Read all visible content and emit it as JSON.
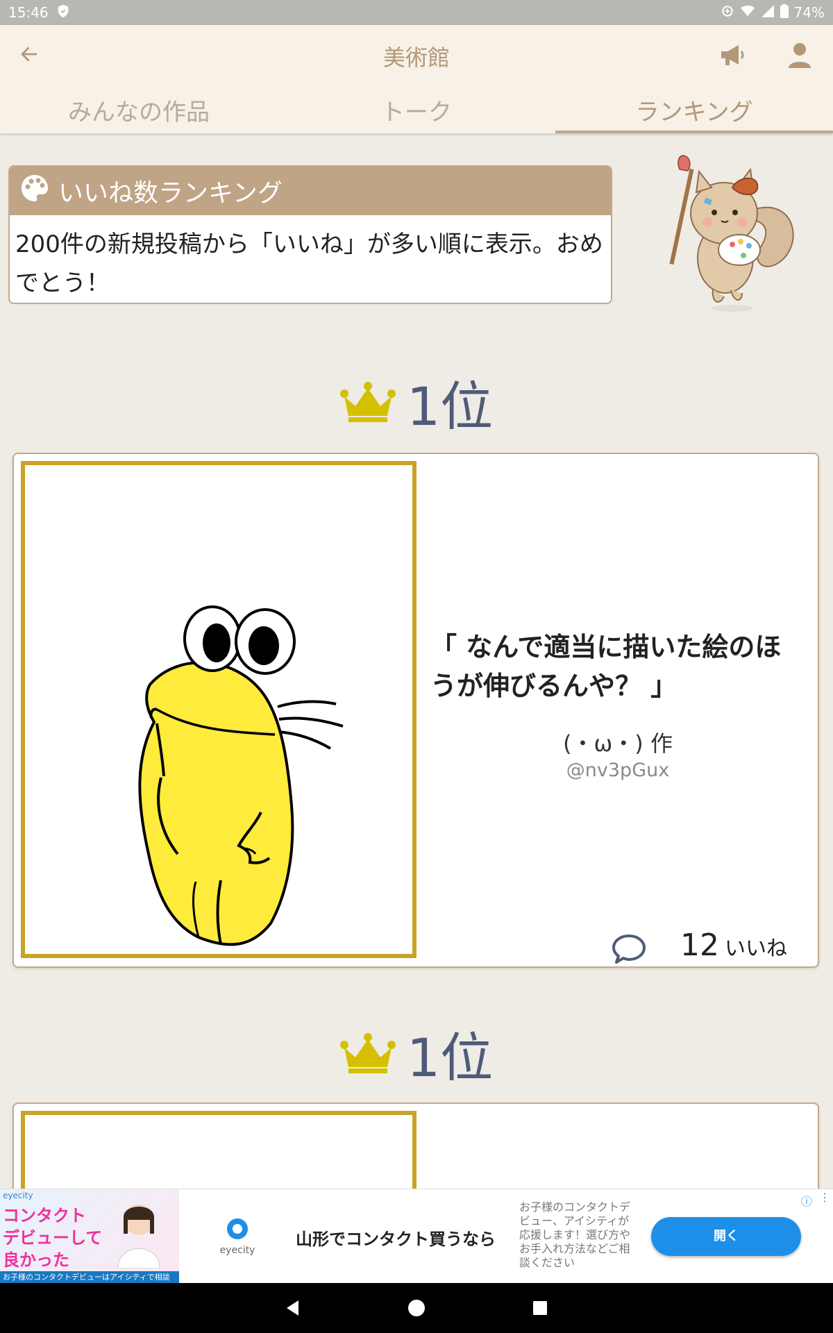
{
  "status_bar": {
    "time": "15:46",
    "battery": "74%"
  },
  "header": {
    "title": "美術館"
  },
  "tabs": [
    {
      "label": "みんなの作品",
      "active": false
    },
    {
      "label": "トーク",
      "active": false
    },
    {
      "label": "ランキング",
      "active": true
    }
  ],
  "ranking_info": {
    "title": "いいね数ランキング",
    "description": "200件の新規投稿から「いいね」が多い順に表示。おめでとう！"
  },
  "ranking": [
    {
      "rank_label": "1位",
      "title": "「 なんで適当に描いた絵のほうが伸びるんや？ 」",
      "author": "(・ω・) 作",
      "handle": "@nv3pGux",
      "likes": "12",
      "likes_unit": "いいね"
    },
    {
      "rank_label": "1位"
    }
  ],
  "ad": {
    "brand": "eyecity",
    "image_headline": [
      "コンタクト",
      "デビューして",
      "良かった"
    ],
    "image_footer": "お子様のコンタクトデビューはアイシティで相談",
    "logo_name": "eyecity",
    "headline": "山形でコンタクト買うなら",
    "body": "お子様のコンタクトデビュー、アイシティが応援します！選び方やお手入れ方法などご相談ください",
    "cta": "開く"
  },
  "colors": {
    "accent": "#b39878",
    "card_border": "#c4a88a",
    "frame_gold": "#c9a227",
    "rank_text": "#4e5b78",
    "crown": "#d4c000"
  }
}
